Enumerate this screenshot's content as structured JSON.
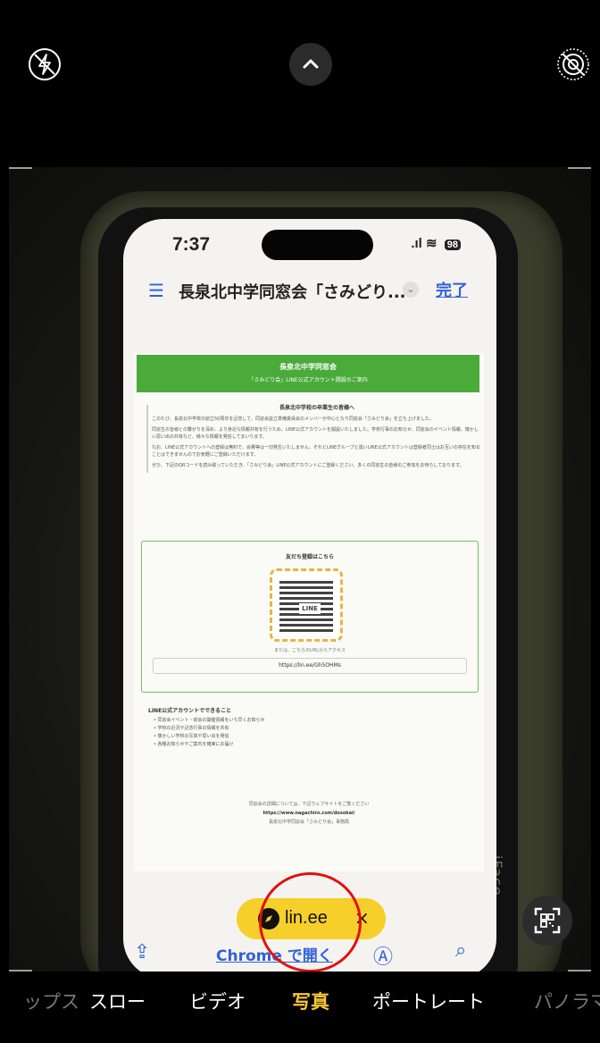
{
  "top_bar": {
    "flash_icon": "flash-off-icon",
    "chevron_icon": "chevron-up-icon",
    "live_icon": "live-photo-off-icon"
  },
  "photographed_phone": {
    "status_time": "7:37",
    "status_battery": "98",
    "browser_title": "長泉北中学同窓会「さみどり...",
    "done_label": "完了",
    "doc": {
      "header_title": "長泉北中学同窓会",
      "header_subtitle": "「さみどり会」LINE公式アカウント開設のご案内",
      "intro_title": "長泉北中学校の卒業生の皆様へ",
      "intro_p1": "このたび、長泉北中学校の創立50周年を記念して、同窓会設立準備委員会のメンバーが中心となり同窓会「さみどり会」を立ち上げました。",
      "intro_p2": "同窓生の皆様との繋がりを深め、より身近な情報共有を行うため、LINE公式アカウントを開設いたしました。学校行事のお知らせ、同窓会のイベント情報、懐かしい思い出の共有など、様々な情報を発信してまいります。",
      "intro_p3": "なお、LINE公式アカウントへの登録は無料で、会費等は一切発生いたしません。それとLINEグループと違いLINE公式アカウントは登録者同士はお互いの存在を知ることはできませんのでお気軽にご登録いただけます。",
      "intro_p4": "ぜひ、下記のQRコードを読み取っていただき、「さみどり会」LINE公式アカウントにご登録ください。多くの同窓生の皆様のご参加をお待ちしております。",
      "reg_title": "友だち登録はこちら",
      "qr_label": "LINE",
      "qr_alt": "または、こちらのURLからアクセス",
      "qr_url": "https://lin.ee/Gh5OHMs",
      "features_title": "LINE公式アカウントでできること",
      "features": [
        "同窓会イベント・総会の開催情報をいち早くお知らせ",
        "学校の近況や記念行事の情報を共有",
        "懐かしい学校の写真や思い出を発信",
        "各種お知らせやご案内を確実にお届け"
      ],
      "footer_note": "同窓会の詳細については、下記ウェブサイトをご覧ください",
      "footer_link": "https://www.nagachiro.com/dosokai/",
      "footer_org": "長泉北中学同窓会「さみどり会」事務局"
    },
    "chrome_label": "Chrome で開く",
    "case_brand": "iFace"
  },
  "qr_pill": {
    "text": "lin.ee",
    "close": "×"
  },
  "modes": [
    "タイムラプス",
    "スロー",
    "ビデオ",
    "写真",
    "ポートレート",
    "パノラマ"
  ],
  "mode_labels": {
    "timelapse": "ップス",
    "slo": "スロー",
    "video": "ビデオ",
    "photo": "写真",
    "portrait": "ポートレート",
    "pano": "パノラマ"
  },
  "active_mode": "写真",
  "colors": {
    "accent_yellow": "#f7c637",
    "pill_yellow": "#f7cf2a",
    "annotation_red": "#e01010",
    "line_green": "#4aaa3a",
    "ios_blue": "#3062d8"
  }
}
